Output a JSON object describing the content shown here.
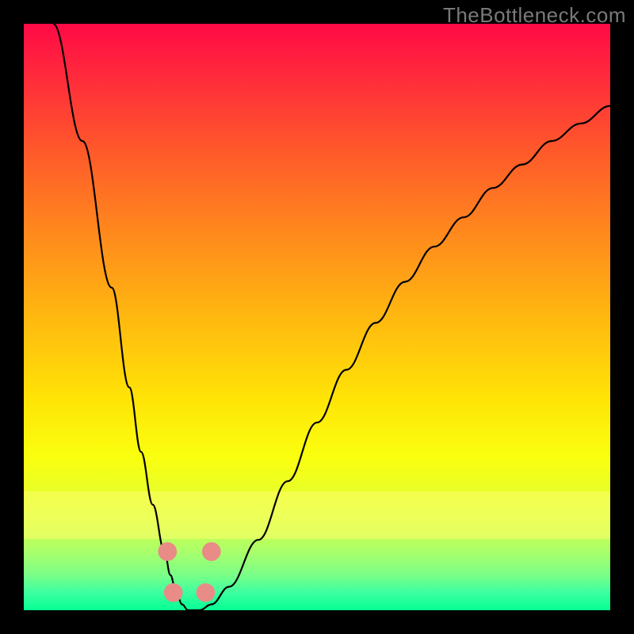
{
  "watermark": "TheBottleneck.com",
  "chart_data": {
    "type": "line",
    "title": "",
    "xlabel": "",
    "ylabel": "",
    "xlim": [
      0,
      100
    ],
    "ylim": [
      0,
      100
    ],
    "background_gradient": {
      "top_color": "#ff0a46",
      "bottom_color": "#06ff94",
      "stops": [
        {
          "pos": 0,
          "color": "#ff0a46"
        },
        {
          "pos": 10,
          "color": "#ff2e3a"
        },
        {
          "pos": 22,
          "color": "#ff5a2a"
        },
        {
          "pos": 36,
          "color": "#ff8a1c"
        },
        {
          "pos": 50,
          "color": "#ffb810"
        },
        {
          "pos": 64,
          "color": "#ffe406"
        },
        {
          "pos": 74,
          "color": "#faff0f"
        },
        {
          "pos": 80,
          "color": "#e8ff2a"
        },
        {
          "pos": 85,
          "color": "#d2ff4a"
        },
        {
          "pos": 90,
          "color": "#aaff6a"
        },
        {
          "pos": 94,
          "color": "#7aff88"
        },
        {
          "pos": 97,
          "color": "#3cffa0"
        },
        {
          "pos": 100,
          "color": "#06ff94"
        }
      ]
    },
    "series": [
      {
        "name": "bottleneck-curve",
        "color": "#000000",
        "x": [
          5,
          10,
          15,
          18,
          20,
          22,
          24,
          25,
          26,
          27,
          28,
          30,
          32,
          35,
          40,
          45,
          50,
          55,
          60,
          65,
          70,
          75,
          80,
          85,
          90,
          95,
          100
        ],
        "y": [
          100,
          80,
          55,
          38,
          27,
          18,
          10,
          6,
          3,
          1,
          0,
          0,
          1,
          4,
          12,
          22,
          32,
          41,
          49,
          56,
          62,
          67,
          72,
          76,
          80,
          83,
          86
        ]
      }
    ],
    "markers": {
      "name": "dip-markers",
      "color": "#e98b86",
      "points": [
        {
          "x": 24.5,
          "y": 10
        },
        {
          "x": 32.0,
          "y": 10
        },
        {
          "x": 25.5,
          "y": 3
        },
        {
          "x": 31.0,
          "y": 3
        }
      ],
      "radius": 1.6
    },
    "yellow_band": {
      "y_from": 12,
      "y_to": 20
    }
  }
}
